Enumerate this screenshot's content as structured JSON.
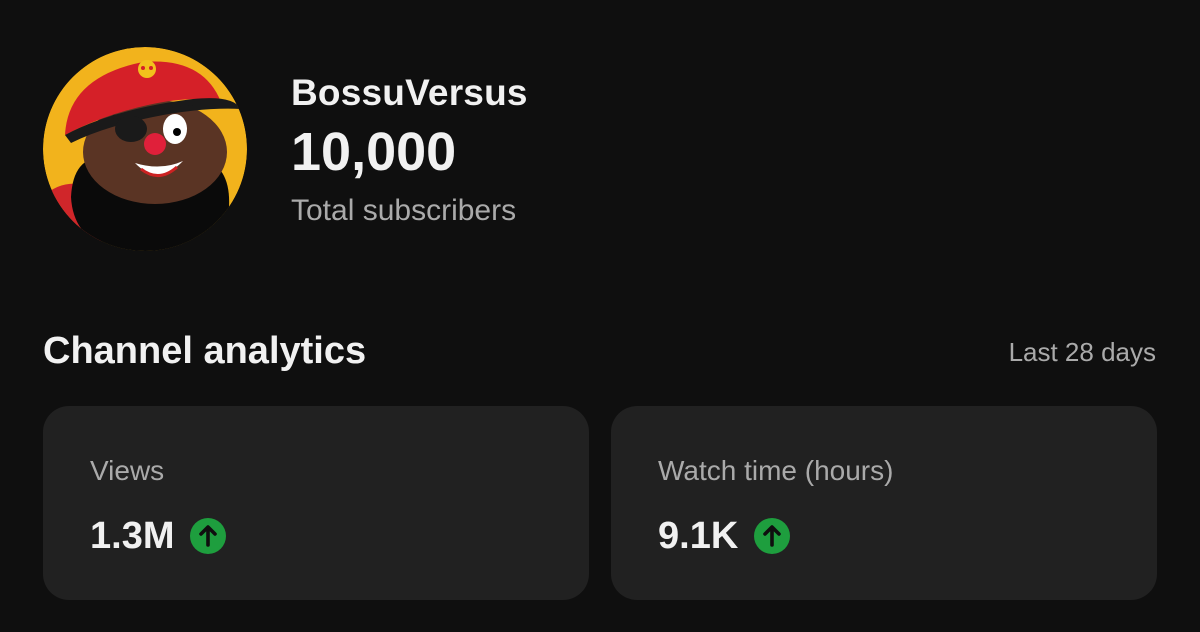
{
  "channel": {
    "name": "BossuVersus",
    "subscriber_count": "10,000",
    "subscriber_label": "Total subscribers"
  },
  "analytics": {
    "title": "Channel analytics",
    "period": "Last 28 days",
    "cards": [
      {
        "label": "Views",
        "value": "1.3M",
        "trend": "up"
      },
      {
        "label": "Watch time (hours)",
        "value": "9.1K",
        "trend": "up"
      }
    ]
  },
  "colors": {
    "background": "#0f0f0f",
    "card": "#212121",
    "trend_up": "#1e9e3e",
    "avatar_bg": "#f2b31c"
  },
  "icons": {
    "trend": "arrow-up-circle-icon",
    "avatar": "pirate-avatar"
  }
}
